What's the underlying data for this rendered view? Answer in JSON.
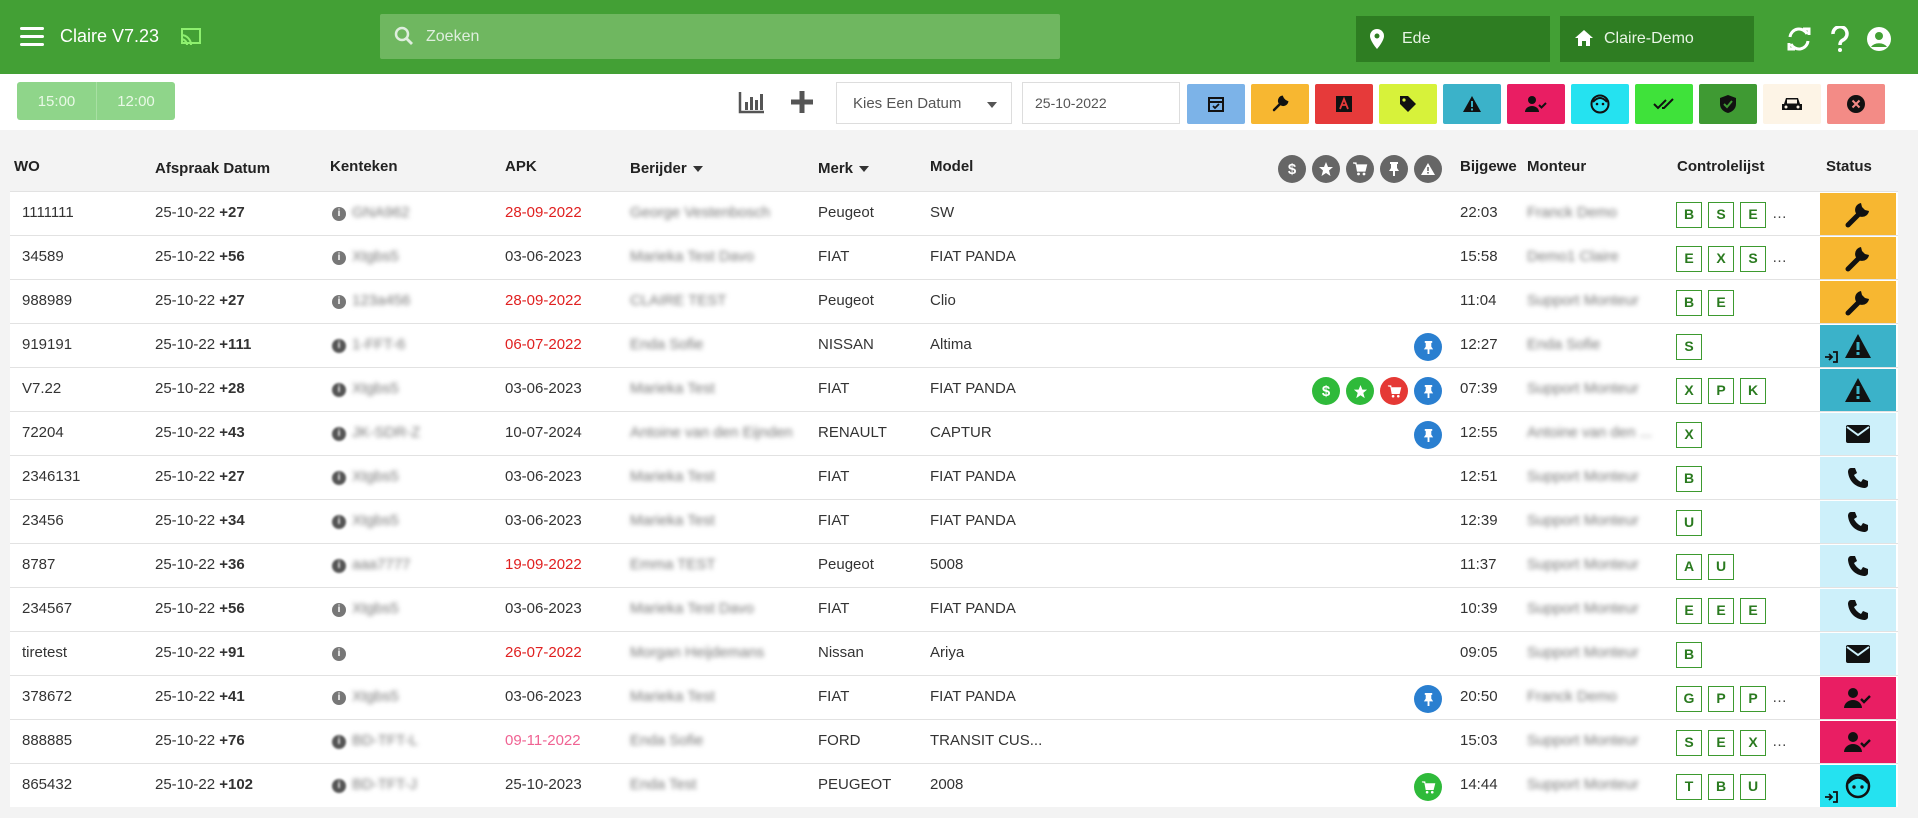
{
  "app": {
    "title": "Claire V7.23"
  },
  "search": {
    "placeholder": "Zoeken"
  },
  "location": {
    "value": "Ede"
  },
  "company": {
    "value": "Claire-Demo"
  },
  "toolbar": {
    "time_buttons": [
      "15:00",
      "12:00"
    ],
    "date_select_label": "Kies Een Datum",
    "date_value": "25-10-2022",
    "filter_buttons": [
      {
        "icon": "calendar-check-icon",
        "color": "#7cb3e8"
      },
      {
        "icon": "wrench-icon",
        "color": "#f7b731"
      },
      {
        "icon": "apk-icon",
        "color": "#e63a3a"
      },
      {
        "icon": "tag-icon",
        "color": "#d7f23a"
      },
      {
        "icon": "warning-icon",
        "color": "#3bb2c9"
      },
      {
        "icon": "user-check-icon",
        "color": "#e91e63"
      },
      {
        "icon": "face-icon",
        "color": "#25e2f0"
      },
      {
        "icon": "double-check-icon",
        "color": "#3fe23a"
      },
      {
        "icon": "shield-check-icon",
        "color": "#3f9a33"
      },
      {
        "icon": "car-icon",
        "color": "#fdf4e6"
      },
      {
        "icon": "close-circle-icon",
        "color": "#f38b86"
      }
    ]
  },
  "table": {
    "headers": {
      "wo": "WO",
      "afspraak": "Afspraak Datum",
      "kenteken": "Kenteken",
      "apk": "APK",
      "berijder": "Berijder",
      "merk": "Merk",
      "model": "Model",
      "bijgewerkt": "Bijgewe",
      "monteur": "Monteur",
      "controlelijst": "Controlelijst",
      "status": "Status"
    },
    "rows": [
      {
        "wo": "1111111",
        "date": "25-10-22",
        "plus": "+27",
        "kenteken": "GNA962",
        "apk": "28-09-2022",
        "apk_color": "red",
        "berijder": "George Vestenbosch",
        "merk": "Peugeot",
        "model": "SW",
        "time": "22:03",
        "monteur": "Franck Demo",
        "checks": [
          "B",
          "S",
          "E"
        ],
        "more": true,
        "status": "wrench-icon",
        "status_color": "#f7b731",
        "icons": []
      },
      {
        "wo": "34589",
        "date": "25-10-22",
        "plus": "+56",
        "kenteken": "Xtgbs5",
        "apk": "03-06-2023",
        "apk_color": "",
        "berijder": "Marieka Test Davo",
        "merk": "FIAT",
        "model": "FIAT PANDA",
        "time": "15:58",
        "monteur": "Demo1 Claire",
        "checks": [
          "E",
          "X",
          "S"
        ],
        "more": true,
        "status": "wrench-icon",
        "status_color": "#f7b731",
        "icons": []
      },
      {
        "wo": "988989",
        "date": "25-10-22",
        "plus": "+27",
        "kenteken": "123a456",
        "apk": "28-09-2022",
        "apk_color": "red",
        "berijder": "CLAIRE TEST",
        "merk": "Peugeot",
        "model": "Clio",
        "time": "11:04",
        "monteur": "Support Monteur",
        "checks": [
          "B",
          "E"
        ],
        "more": false,
        "status": "wrench-icon",
        "status_color": "#f7b731",
        "icons": []
      },
      {
        "wo": "919191",
        "date": "25-10-22",
        "plus": "+111",
        "kenteken": "1-FFT-6",
        "apk": "06-07-2022",
        "apk_color": "red",
        "berijder": "Enda Sofie",
        "merk": "NISSAN",
        "model": "Altima",
        "time": "12:27",
        "monteur": "Enda Sofie",
        "checks": [
          "S"
        ],
        "more": false,
        "status": "warning-icon",
        "status_color": "#3bb2c9",
        "icons": [
          "pin"
        ]
      },
      {
        "wo": "V7.22",
        "date": "25-10-22",
        "plus": "+28",
        "kenteken": "Xtgbs5",
        "apk": "03-06-2023",
        "apk_color": "",
        "berijder": "Marieka Test",
        "merk": "FIAT",
        "model": "FIAT PANDA",
        "time": "07:39",
        "monteur": "Support Monteur",
        "checks": [
          "X",
          "P",
          "K"
        ],
        "more": false,
        "status": "warning-icon",
        "status_color": "#3bb2c9",
        "icons": [
          "dollar",
          "star",
          "cart",
          "pin"
        ]
      },
      {
        "wo": "72204",
        "date": "25-10-22",
        "plus": "+43",
        "kenteken": "JK-SDR-Z",
        "apk": "10-07-2024",
        "apk_color": "",
        "berijder": "Antoine van den Eijnden",
        "merk": "RENAULT",
        "model": "CAPTUR",
        "time": "12:55",
        "monteur": "Antoine van den ...",
        "checks": [
          "X"
        ],
        "more": false,
        "status": "mail-icon",
        "status_color": "#cdf0fa",
        "icons": [
          "pin"
        ]
      },
      {
        "wo": "2346131",
        "date": "25-10-22",
        "plus": "+27",
        "kenteken": "Xtgbs5",
        "apk": "03-06-2023",
        "apk_color": "",
        "berijder": "Marieka Test",
        "merk": "FIAT",
        "model": "FIAT PANDA",
        "time": "12:51",
        "monteur": "Support Monteur",
        "checks": [
          "B"
        ],
        "more": false,
        "status": "phone-icon",
        "status_color": "#cdf0fa",
        "icons": []
      },
      {
        "wo": "23456",
        "date": "25-10-22",
        "plus": "+34",
        "kenteken": "Xtgbs5",
        "apk": "03-06-2023",
        "apk_color": "",
        "berijder": "Marieka Test",
        "merk": "FIAT",
        "model": "FIAT PANDA",
        "time": "12:39",
        "monteur": "Support Monteur",
        "checks": [
          "U"
        ],
        "more": false,
        "status": "phone-icon",
        "status_color": "#cdf0fa",
        "icons": []
      },
      {
        "wo": "8787",
        "date": "25-10-22",
        "plus": "+36",
        "kenteken": "aaa7777",
        "apk": "19-09-2022",
        "apk_color": "red",
        "berijder": "Emma TEST",
        "merk": "Peugeot",
        "model": "5008",
        "time": "11:37",
        "monteur": "Support Monteur",
        "checks": [
          "A",
          "U"
        ],
        "more": false,
        "status": "phone-icon",
        "status_color": "#cdf0fa",
        "icons": []
      },
      {
        "wo": "234567",
        "date": "25-10-22",
        "plus": "+56",
        "kenteken": "Xtgbs5",
        "apk": "03-06-2023",
        "apk_color": "",
        "berijder": "Marieka Test Davo",
        "merk": "FIAT",
        "model": "FIAT PANDA",
        "time": "10:39",
        "monteur": "Support Monteur",
        "checks": [
          "E",
          "E",
          "E"
        ],
        "more": false,
        "status": "phone-icon",
        "status_color": "#cdf0fa",
        "icons": []
      },
      {
        "wo": "tiretest",
        "date": "25-10-22",
        "plus": "+91",
        "kenteken": "",
        "apk": "26-07-2022",
        "apk_color": "red",
        "berijder": "Morgan Heijdemans",
        "merk": "Nissan",
        "model": "Ariya",
        "time": "09:05",
        "monteur": "Support Monteur",
        "checks": [
          "B"
        ],
        "more": false,
        "status": "mail-icon",
        "status_color": "#cdf0fa",
        "icons": []
      },
      {
        "wo": "378672",
        "date": "25-10-22",
        "plus": "+41",
        "kenteken": "Xtgbs5",
        "apk": "03-06-2023",
        "apk_color": "",
        "berijder": "Marieka Test",
        "merk": "FIAT",
        "model": "FIAT PANDA",
        "time": "20:50",
        "monteur": "Franck Demo",
        "checks": [
          "G",
          "P",
          "P"
        ],
        "more": true,
        "status": "user-check-icon",
        "status_color": "#e91e63",
        "icons": [
          "pin"
        ]
      },
      {
        "wo": "888885",
        "date": "25-10-22",
        "plus": "+76",
        "kenteken": "BD-TFT-L",
        "apk": "09-11-2022",
        "apk_color": "pink",
        "berijder": "Enda Sofie",
        "merk": "FORD",
        "model": "TRANSIT CUS...",
        "time": "15:03",
        "monteur": "Support Monteur",
        "checks": [
          "S",
          "E",
          "X"
        ],
        "more": true,
        "status": "user-check-icon",
        "status_color": "#e91e63",
        "icons": []
      },
      {
        "wo": "865432",
        "date": "25-10-22",
        "plus": "+102",
        "kenteken": "BD-TFT-J",
        "apk": "25-10-2023",
        "apk_color": "",
        "berijder": "Enda Test",
        "merk": "PEUGEOT",
        "model": "2008",
        "time": "14:44",
        "monteur": "Support Monteur",
        "checks": [
          "T",
          "B",
          "U"
        ],
        "more": false,
        "status": "face-icon",
        "status_color": "#25e2f0",
        "icons": [
          "cart-green"
        ]
      }
    ]
  }
}
